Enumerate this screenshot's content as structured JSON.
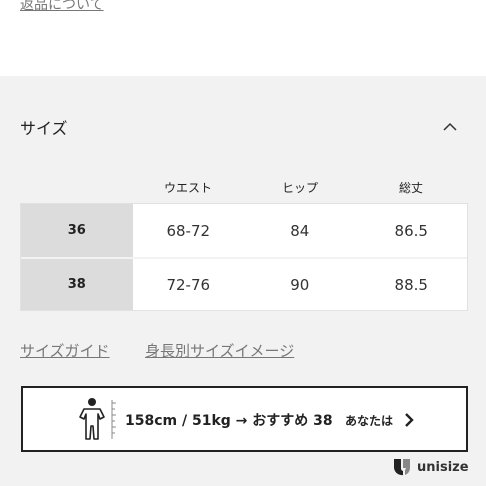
{
  "return_link": "返品について",
  "size_section": {
    "title": "サイズ",
    "columns": [
      "ウエスト",
      "ヒップ",
      "総丈"
    ],
    "rows": [
      {
        "size": "36",
        "values": [
          "68-72",
          "84",
          "86.5"
        ]
      },
      {
        "size": "38",
        "values": [
          "72-76",
          "90",
          "88.5"
        ]
      }
    ]
  },
  "links": {
    "size_guide": "サイズガイド",
    "height_image": "身長別サイズイメージ"
  },
  "unisize_widget": {
    "recommendation": "158cm / 51kg → おすすめ 38",
    "you_label": "あなたは"
  },
  "brand": {
    "name": "unisize"
  },
  "icons": {
    "collapse": "chevron-up-icon",
    "figure": "person-measure-icon",
    "go": "chevron-right-icon",
    "logo": "unisize-logo-icon"
  }
}
